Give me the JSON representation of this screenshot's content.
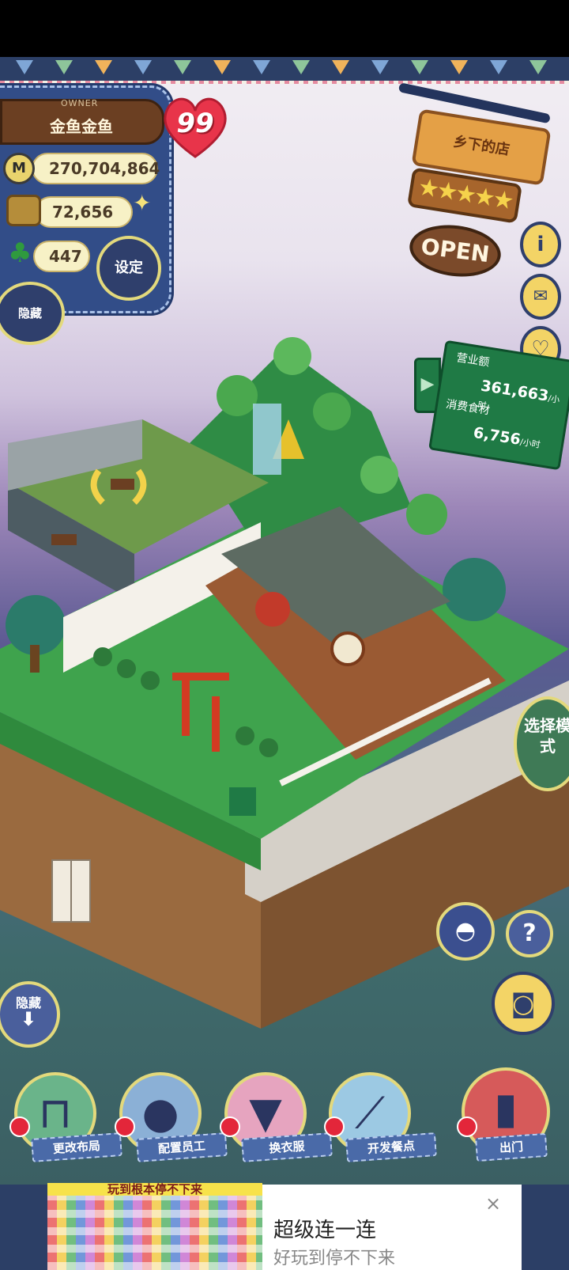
{
  "owner": {
    "label": "OWNER",
    "name": "金鱼金鱼",
    "level": "99",
    "money": "270,704,864",
    "money_icon": "M",
    "ingredients": "72,656",
    "clovers": "447",
    "settings_label": "设定",
    "hide_label": "隐藏"
  },
  "shop": {
    "name": "乡下的店",
    "stars": "★★★★★",
    "status": "OPEN"
  },
  "side_buttons": [
    "i",
    "✉",
    "♡"
  ],
  "revenue": {
    "revenue_label": "营业额",
    "revenue_value": "361,663",
    "per_hour": "/小时",
    "consume_label": "消费食材",
    "consume_value": "6,756",
    "arrow": "▶"
  },
  "mode_button": "选择模式",
  "help_label": "?",
  "hide_bottom_label": "隐藏",
  "toolbar": [
    {
      "label": "更改布局",
      "icon": "table-icon",
      "color": "#6ab48a"
    },
    {
      "label": "配置员工",
      "icon": "bear-icon",
      "color": "#8bb0d6"
    },
    {
      "label": "换衣服",
      "icon": "shirt-icon",
      "color": "#e6a4bf"
    },
    {
      "label": "开发餐点",
      "icon": "knife-icon",
      "color": "#9cc9e3"
    },
    {
      "label": "出门",
      "icon": "door-icon",
      "color": "#d65a5a"
    }
  ],
  "ad": {
    "banner": "玩到根本停不下来",
    "title": "超级连一连",
    "subtitle": "好玩到停不下来",
    "close": "×"
  },
  "colors": {
    "panel": "#324d88",
    "accent": "#e3d97c",
    "sign": "#e4a046",
    "board": "#1f7a45"
  }
}
